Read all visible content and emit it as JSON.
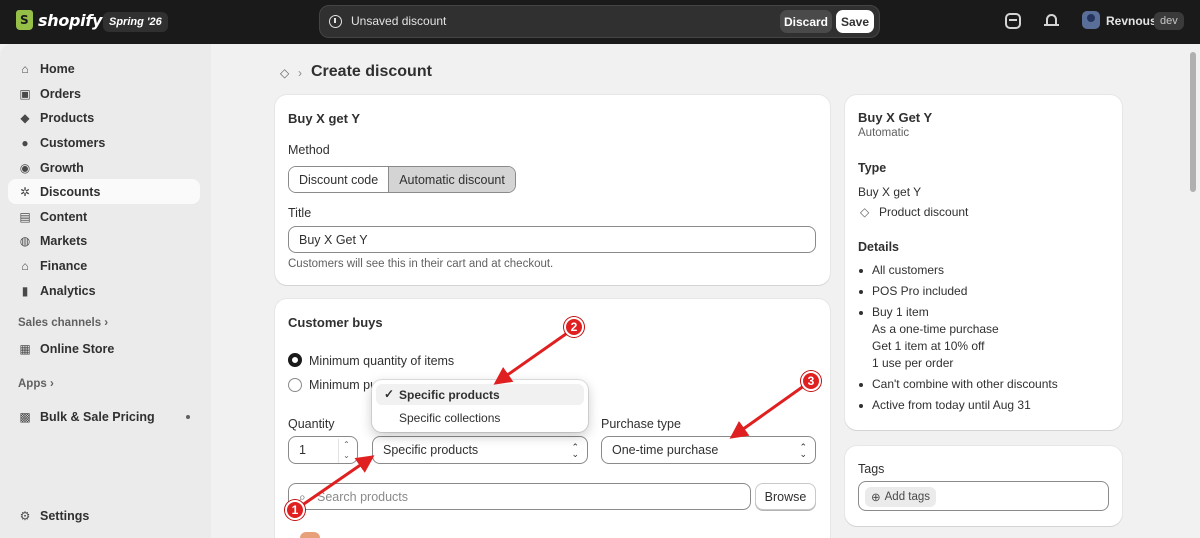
{
  "topbar": {
    "brand": "shopify",
    "edition": "Spring '26",
    "unsaved_text": "Unsaved discount",
    "discard_label": "Discard",
    "save_label": "Save",
    "store_name": "Revnous",
    "env_badge": "dev"
  },
  "sidebar": {
    "items": [
      {
        "label": "Home",
        "icon": "home-icon"
      },
      {
        "label": "Orders",
        "icon": "orders-icon"
      },
      {
        "label": "Products",
        "icon": "tag-icon"
      },
      {
        "label": "Customers",
        "icon": "person-icon"
      },
      {
        "label": "Growth",
        "icon": "growth-icon"
      },
      {
        "label": "Discounts",
        "icon": "discount-icon"
      },
      {
        "label": "Content",
        "icon": "content-icon"
      },
      {
        "label": "Markets",
        "icon": "globe-icon"
      },
      {
        "label": "Finance",
        "icon": "bank-icon"
      },
      {
        "label": "Analytics",
        "icon": "chart-icon"
      }
    ],
    "active": "Discounts",
    "sales_channels_label": "Sales channels",
    "online_store_label": "Online Store",
    "apps_label": "Apps",
    "bulk_pricing_label": "Bulk & Sale Pricing",
    "settings_label": "Settings"
  },
  "page": {
    "title": "Create discount"
  },
  "discount_card": {
    "heading": "Buy X get Y",
    "method_label": "Method",
    "method_options": [
      "Discount code",
      "Automatic discount"
    ],
    "method_selected": "Automatic discount",
    "title_label": "Title",
    "title_value": "Buy X Get Y",
    "title_help": "Customers will see this in their cart and at checkout."
  },
  "customer_buys": {
    "heading": "Customer buys",
    "option_min_qty": "Minimum quantity of items",
    "option_min_amount_partial": "Minimum pu",
    "quantity_label": "Quantity",
    "quantity_value": "1",
    "any_items_value": "Specific products",
    "purchase_type_label": "Purchase type",
    "purchase_type_value": "One-time purchase",
    "search_placeholder": "Search products",
    "browse_label": "Browse",
    "dropdown_options": [
      "Specific products",
      "Specific collections"
    ],
    "dropdown_selected": "Specific products"
  },
  "summary": {
    "title": "Buy X Get Y",
    "subtitle": "Automatic",
    "type_heading": "Type",
    "type_value": "Buy X get Y",
    "type_kind": "Product discount",
    "details_heading": "Details",
    "details": [
      [
        "All customers"
      ],
      [
        "POS Pro included"
      ],
      [
        "Buy 1 item",
        "As a one-time purchase",
        "Get 1 item at 10% off",
        "1 use per order"
      ],
      [
        "Can't combine with other discounts"
      ],
      [
        "Active from today until Aug 31"
      ]
    ]
  },
  "tags": {
    "heading": "Tags",
    "add_label": "Add tags"
  },
  "annotations": {
    "badges": [
      "1",
      "2",
      "3"
    ],
    "color": "#e02020"
  }
}
